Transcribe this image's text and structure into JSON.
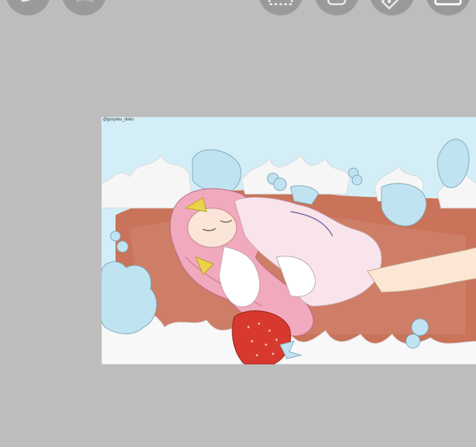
{
  "toolbar": {
    "buttons": [
      {
        "name": "undo",
        "icon": "undo-icon"
      },
      {
        "name": "redo",
        "icon": "redo-icon"
      },
      {
        "name": "select",
        "icon": "selection-icon"
      },
      {
        "name": "layers",
        "icon": "layers-icon"
      },
      {
        "name": "pen",
        "icon": "pen-tool-icon"
      },
      {
        "name": "frame",
        "icon": "frame-icon"
      }
    ]
  },
  "artwork": {
    "credit": "@goryoku_doko",
    "colors": {
      "sky": "#d3eef7",
      "cake": "#c9735a",
      "cream": "#f6f6f6",
      "hair": "#f1a9be",
      "strawberry": "#d7392f",
      "ribbon": "#e9d34a"
    }
  }
}
